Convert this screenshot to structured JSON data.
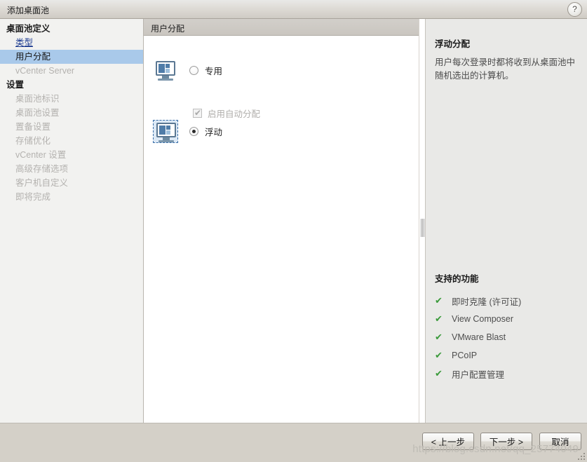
{
  "window": {
    "title": "添加桌面池",
    "help_icon": "?"
  },
  "sidebar": {
    "groups": [
      {
        "label": "桌面池定义",
        "items": [
          {
            "label": "类型",
            "state": "link"
          },
          {
            "label": "用户分配",
            "state": "selected"
          },
          {
            "label": "vCenter Server",
            "state": "disabled"
          }
        ]
      },
      {
        "label": "设置",
        "items": [
          {
            "label": "桌面池标识",
            "state": "disabled"
          },
          {
            "label": "桌面池设置",
            "state": "disabled"
          },
          {
            "label": "置备设置",
            "state": "disabled"
          },
          {
            "label": "存储优化",
            "state": "disabled"
          },
          {
            "label": "vCenter 设置",
            "state": "disabled"
          },
          {
            "label": "高级存储选项",
            "state": "disabled"
          },
          {
            "label": "客户机自定义",
            "state": "disabled"
          },
          {
            "label": "即将完成",
            "state": "disabled"
          }
        ]
      }
    ]
  },
  "main": {
    "header": "用户分配",
    "options": [
      {
        "label": "专用",
        "selected": false,
        "icon": "monitor-icon"
      },
      {
        "label": "浮动",
        "selected": true,
        "icon": "monitor-icon-selected"
      }
    ],
    "sub_checkbox": {
      "label": "启用自动分配",
      "checked": true,
      "disabled": true
    }
  },
  "info_panel": {
    "title": "浮动分配",
    "description": "用户每次登录时都将收到从桌面池中随机选出的计算机。",
    "features_title": "支持的功能",
    "features": [
      "即时克隆 (许可证)",
      "View Composer",
      "VMware Blast",
      "PCoIP",
      "用户配置管理"
    ],
    "check_glyph": "✔",
    "check_color": "#3a9a3a"
  },
  "footer": {
    "back_label": "< 上一步",
    "next_label": "下一步 >",
    "cancel_label": "取消",
    "watermark": "https://blog.csdn.net/qq_25774049"
  }
}
